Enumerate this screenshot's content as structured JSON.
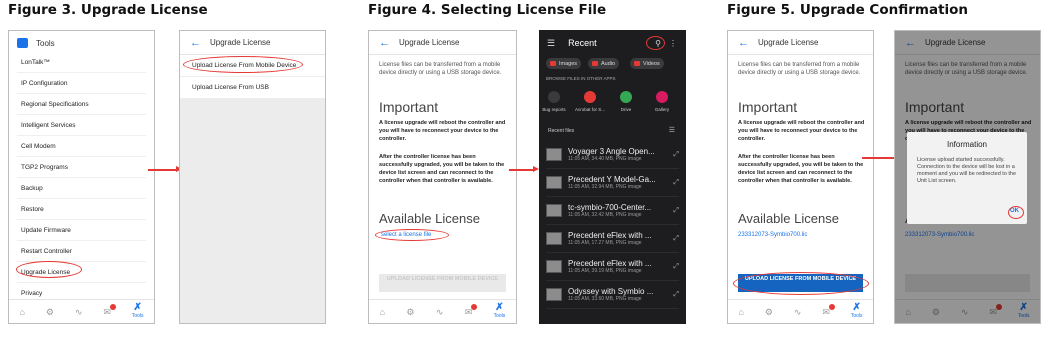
{
  "figures": {
    "fig3": "Figure 3. Upgrade License",
    "fig4": "Figure 4. Selecting License File",
    "fig5": "Figure 5. Upgrade Confirmation"
  },
  "tools_screen": {
    "title": "Tools",
    "items": [
      "LonTalk™",
      "IP Configuration",
      "Regional Specifications",
      "Intelligent Services",
      "Cell Modem",
      "TGP2 Programs",
      "Backup",
      "Restore",
      "Update Firmware",
      "Restart Controller",
      "Upgrade License",
      "Privacy"
    ]
  },
  "upgrade_menu": {
    "title": "Upgrade License",
    "opt_mobile": "Upload License From Mobile Device",
    "opt_usb": "Upload License From USB"
  },
  "upgrade_detail": {
    "title": "Upgrade License",
    "intro": "License files can be transferred from a mobile device directly or using a USB storage device.",
    "important_heading": "Important",
    "warn1": "A license upgrade will reboot the controller and you will have to reconnect your device to the controller.",
    "warn2": "After the controller license has been successfully upgraded, you will be taken to the device list screen and can reconnect to the controller when that controller is available.",
    "available_heading": "Available License",
    "select_link": "select a license file",
    "upload_button": "UPLOAD LICENSE FROM MOBILE DEVICE",
    "selected_file": "233312073-Symbio700.lic"
  },
  "recent": {
    "title": "Recent",
    "chips": [
      "Images",
      "Audio",
      "Videos"
    ],
    "browse_label": "BROWSE FILES IN OTHER APPS",
    "apps": [
      "Bug reports",
      "Acrobat for S...",
      "Drive",
      "Gallery"
    ],
    "recent_label": "Recent files",
    "files": [
      {
        "name": "Voyager 3 Angle Open...",
        "meta": "11:05 AM, 34.40 MB, PNG image"
      },
      {
        "name": "Precedent Y Model-Ga...",
        "meta": "11:05 AM, 32.94 MB, PNG image"
      },
      {
        "name": "tc-symbio-700-Center...",
        "meta": "11:05 AM, 32.42 MB, PNG image"
      },
      {
        "name": "Precedent eFlex with ...",
        "meta": "11:05 AM, 17.27 MB, PNG image"
      },
      {
        "name": "Precedent eFlex with ...",
        "meta": "11:05 AM, 39.19 MB, PNG image"
      },
      {
        "name": "Odyssey with Symbio ...",
        "meta": "11:05 AM, 33.60 MB, PNG image"
      }
    ]
  },
  "dialog": {
    "title": "Information",
    "message": "License upload started successfully. Connection to the device will be lost in a moment and you will be redirected to the Unit List screen.",
    "ok": "OK"
  },
  "nav": {
    "tools": "Tools"
  },
  "colors": {
    "accent": "#1a73e8",
    "annotation": "#e53935",
    "button": "#1565c0",
    "dark_bg": "#1d1d1f"
  }
}
